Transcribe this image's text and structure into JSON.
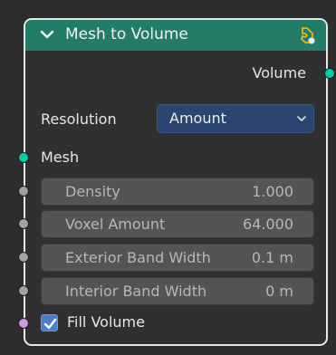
{
  "node": {
    "title": "Mesh to Volume",
    "header_color": "#237b6a",
    "collapse_icon": "chevron-down-icon",
    "tool_icon": "tool-settings-icon"
  },
  "output": {
    "label": "Volume",
    "socket_color": "#00d0a7"
  },
  "resolution": {
    "label": "Resolution",
    "selected": "Amount",
    "dropdown_icon": "chevron-down-icon",
    "dropdown_color": "#2c4570"
  },
  "mesh": {
    "label": "Mesh",
    "socket_color": "#00d0a7"
  },
  "fields": [
    {
      "label": "Density",
      "value": "1.000",
      "socket_color": "#a1a1a1"
    },
    {
      "label": "Voxel Amount",
      "value": "64.000",
      "socket_color": "#a1a1a1"
    },
    {
      "label": "Exterior Band Width",
      "value": "0.1 m",
      "socket_color": "#a1a1a1"
    },
    {
      "label": "Interior Band Width",
      "value": "0 m",
      "socket_color": "#a1a1a1"
    }
  ],
  "fill_volume": {
    "label": "Fill Volume",
    "checked": true,
    "socket_color": "#cc9be0",
    "check_icon": "checkmark-icon",
    "checkbox_color": "#4b7ec8"
  }
}
